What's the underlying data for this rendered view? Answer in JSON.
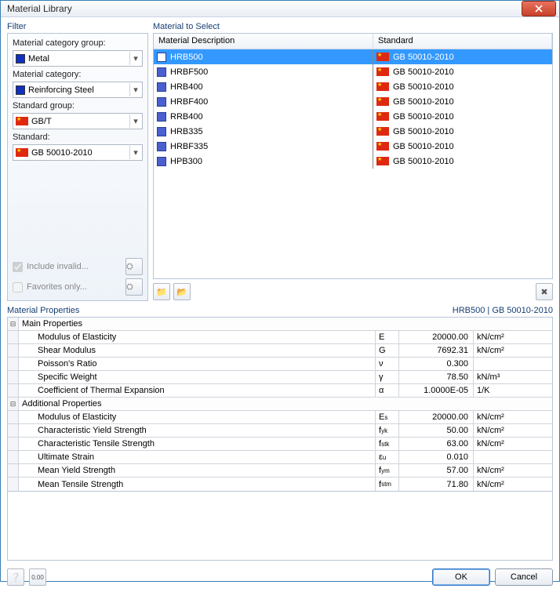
{
  "window": {
    "title": "Material Library"
  },
  "filter": {
    "title": "Filter",
    "cat_group_label": "Material category group:",
    "cat_group_value": "Metal",
    "cat_group_color": "#1030c0",
    "cat_label": "Material category:",
    "cat_value": "Reinforcing Steel",
    "cat_color": "#1030c0",
    "std_group_label": "Standard group:",
    "std_group_value": "GB/T",
    "std_label": "Standard:",
    "std_value": "GB 50010-2010",
    "include_invalid": "Include invalid...",
    "favorites_only": "Favorites only..."
  },
  "select": {
    "title": "Material to Select",
    "col_desc": "Material Description",
    "col_std": "Standard",
    "rows": [
      {
        "desc": "HRB500",
        "std": "GB 50010-2010",
        "sel": true
      },
      {
        "desc": "HRBF500",
        "std": "GB 50010-2010",
        "sel": false
      },
      {
        "desc": "HRB400",
        "std": "GB 50010-2010",
        "sel": false
      },
      {
        "desc": "HRBF400",
        "std": "GB 50010-2010",
        "sel": false
      },
      {
        "desc": "RRB400",
        "std": "GB 50010-2010",
        "sel": false
      },
      {
        "desc": "HRB335",
        "std": "GB 50010-2010",
        "sel": false
      },
      {
        "desc": "HRBF335",
        "std": "GB 50010-2010",
        "sel": false
      },
      {
        "desc": "HPB300",
        "std": "GB 50010-2010",
        "sel": false
      }
    ]
  },
  "props": {
    "title": "Material Properties",
    "context": "HRB500  |  GB 50010-2010",
    "group_main": "Main Properties",
    "group_add": "Additional Properties",
    "main": [
      {
        "name": "Modulus of Elasticity",
        "sym": "E",
        "val": "20000.00",
        "unit": "kN/cm²"
      },
      {
        "name": "Shear Modulus",
        "sym": "G",
        "val": "7692.31",
        "unit": "kN/cm²"
      },
      {
        "name": "Poisson's Ratio",
        "sym": "ν",
        "val": "0.300",
        "unit": ""
      },
      {
        "name": "Specific Weight",
        "sym": "γ",
        "val": "78.50",
        "unit": "kN/m³"
      },
      {
        "name": "Coefficient of Thermal Expansion",
        "sym": "α",
        "val": "1.0000E-05",
        "unit": "1/K"
      }
    ],
    "add": [
      {
        "name": "Modulus of Elasticity",
        "sym": "E<sub>s</sub>",
        "val": "20000.00",
        "unit": "kN/cm²"
      },
      {
        "name": "Characteristic Yield Strength",
        "sym": "f<sub>yk</sub>",
        "val": "50.00",
        "unit": "kN/cm²"
      },
      {
        "name": "Characteristic Tensile Strength",
        "sym": "f<sub>stk</sub>",
        "val": "63.00",
        "unit": "kN/cm²"
      },
      {
        "name": "Ultimate Strain",
        "sym": "ε<sub>u</sub>",
        "val": "0.010",
        "unit": ""
      },
      {
        "name": "Mean Yield Strength",
        "sym": "f<sub>ym</sub>",
        "val": "57.00",
        "unit": "kN/cm²"
      },
      {
        "name": "Mean Tensile Strength",
        "sym": "f<sub>stm</sub>",
        "val": "71.80",
        "unit": "kN/cm²"
      }
    ]
  },
  "footer": {
    "ok": "OK",
    "cancel": "Cancel"
  }
}
